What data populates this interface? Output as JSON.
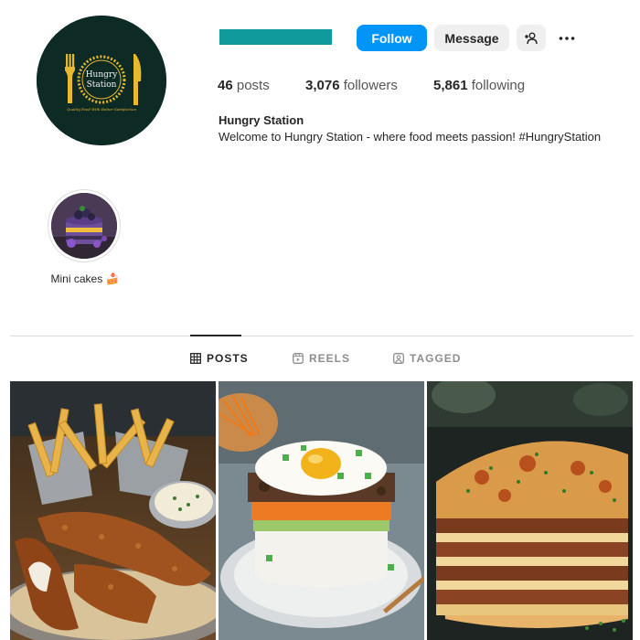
{
  "profile": {
    "avatar_text_line1": "Hungry",
    "avatar_text_line2": "Station",
    "avatar_tagline": "Quality Food With Better Satisfaction",
    "name": "Hungry Station",
    "bio": "Welcome to Hungry Station - where food meets passion! #HungryStation"
  },
  "actions": {
    "follow_label": "Follow",
    "message_label": "Message",
    "suggest_icon": "person-add-icon",
    "more_icon": "more-horizontal-icon"
  },
  "stats": {
    "posts_count": "46",
    "posts_label": "posts",
    "followers_count": "3,076",
    "followers_label": "followers",
    "following_count": "5,861",
    "following_label": "following"
  },
  "highlights": [
    {
      "label": "Mini cakes 🍰"
    }
  ],
  "tabs": [
    {
      "label": "POSTS",
      "icon": "grid-icon",
      "active": true
    },
    {
      "label": "REELS",
      "icon": "reels-icon",
      "active": false
    },
    {
      "label": "TAGGED",
      "icon": "tagged-icon",
      "active": false
    }
  ],
  "posts": [
    {
      "subject": "fried chicken tenders with fries and dip"
    },
    {
      "subject": "rice bowl with beef, carrots and fried egg"
    },
    {
      "subject": "layered lasagna with herbs"
    }
  ],
  "colors": {
    "accent": "#0095f6",
    "username_bar": "#119a9c",
    "avatar_bg": "#0d2a25",
    "avatar_gold": "#e8b92f"
  }
}
